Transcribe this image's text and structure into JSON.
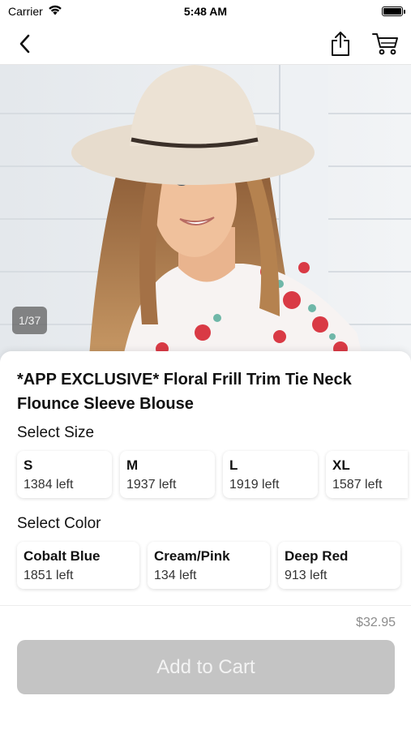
{
  "status_bar": {
    "carrier": "Carrier",
    "time": "5:48 AM"
  },
  "nav": {
    "back_icon": "chevron-left-icon",
    "share_icon": "share-icon",
    "cart_icon": "cart-icon"
  },
  "gallery": {
    "counter": "1/37"
  },
  "product": {
    "title": "*APP EXCLUSIVE* Floral Frill Trim Tie Neck Flounce Sleeve Blouse",
    "price": "$32.95"
  },
  "sizes": {
    "label": "Select Size",
    "options": [
      {
        "name": "S",
        "stock": "1384 left"
      },
      {
        "name": "M",
        "stock": "1937 left"
      },
      {
        "name": "L",
        "stock": "1919 left"
      },
      {
        "name": "XL",
        "stock": "1587 left"
      }
    ]
  },
  "colors": {
    "label": "Select Color",
    "options": [
      {
        "name": "Cobalt Blue",
        "stock": "1851 left"
      },
      {
        "name": "Cream/Pink",
        "stock": "134 left"
      },
      {
        "name": "Deep Red",
        "stock": "913 left"
      }
    ]
  },
  "cta": {
    "label": "Add to Cart",
    "color": "#c4c4c4"
  }
}
